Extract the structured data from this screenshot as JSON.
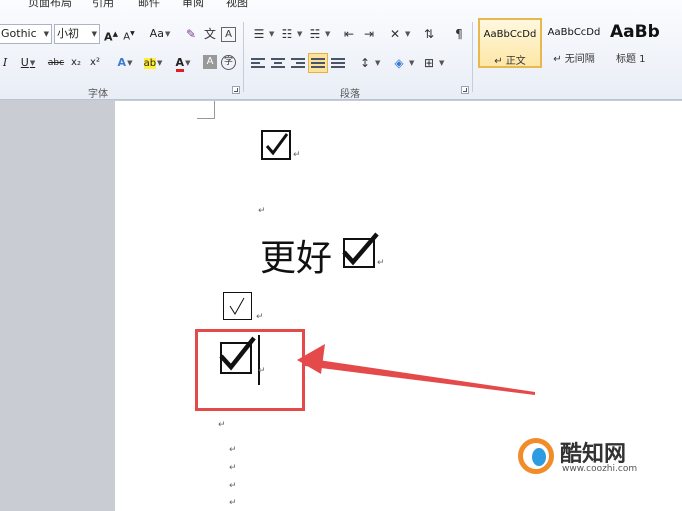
{
  "tabs": [
    "页面布局",
    "引用",
    "邮件",
    "审阅",
    "视图"
  ],
  "font_group": {
    "font_name": "Gothic",
    "font_size": "小初",
    "label": "字体",
    "buttons": [
      "A",
      "A",
      "Aa",
      "I",
      "U",
      "abc",
      "x₂",
      "x²",
      "A",
      "ab",
      "A",
      "A",
      "字"
    ]
  },
  "paragraph_group": {
    "label": "段落"
  },
  "styles": [
    {
      "sample": "AaBbCcDd",
      "name": "↵ 正文",
      "selected": true
    },
    {
      "sample": "AaBbCcDd",
      "name": "↵ 无间隔",
      "selected": false
    },
    {
      "sample": "AaBb",
      "name": "标题 1",
      "selected": false
    }
  ],
  "document": {
    "paragraph_mark": "↵",
    "text_line": "更好"
  },
  "watermark": {
    "brand": "酷知网",
    "site": "www.coozhi.com"
  },
  "colors": {
    "highlight_border": "#e54a4a",
    "arrow": "#e54a4a",
    "selected_style": "#e6b84f"
  }
}
